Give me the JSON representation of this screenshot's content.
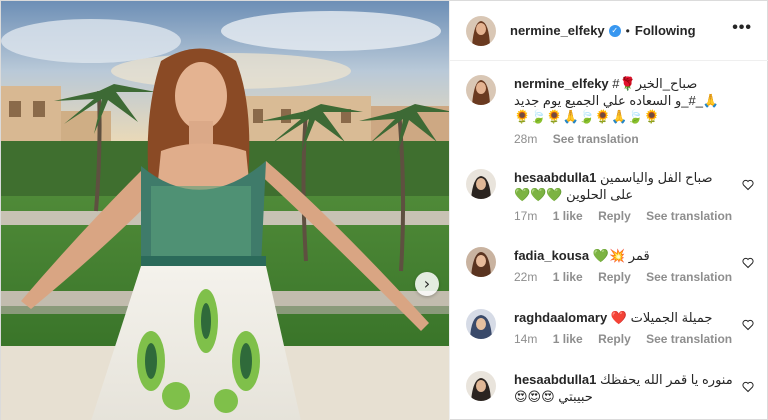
{
  "post": {
    "username": "nermine_elfeky",
    "follow_state": "Following",
    "separator": "•",
    "more": "•••",
    "next_arrow": "›",
    "caption_line1": "صباح_الخير🌹#",
    "caption_line2": "🙏_#_و السعاده علي الجميع يوم جديد",
    "caption_line3": "🌻🍃🌻🙏🍃🌻🙏🍃🌻",
    "caption_time": "28m",
    "see_translation": "See translation"
  },
  "comments": [
    {
      "username": "hesaabdulla1",
      "text": "صباح الفل والياسمين",
      "text2": "على الحلوين 💚💚💚",
      "time": "17m",
      "likes": "1 like",
      "reply": "Reply",
      "see_translation": "See translation"
    },
    {
      "username": "fadia_kousa",
      "text": "قمر 💥💚",
      "time": "22m",
      "likes": "1 like",
      "reply": "Reply",
      "see_translation": "See translation"
    },
    {
      "username": "raghdaalomary",
      "text": "جميلة الجميلات ❤️",
      "time": "14m",
      "likes": "1 like",
      "reply": "Reply",
      "see_translation": "See translation"
    },
    {
      "username": "hesaabdulla1",
      "text": "منوره يا قمر الله يحفظك",
      "text2": "حبيبتي 😍😍😍"
    }
  ],
  "colors": {
    "accent_blue": "#3897f0",
    "text_primary": "#262626",
    "text_secondary": "#8e8e8e",
    "border": "#dbdbdb"
  },
  "icons": {
    "verified": "verified-badge-icon",
    "heart": "heart-outline-icon",
    "next": "chevron-right-icon",
    "more": "more-options-icon"
  }
}
